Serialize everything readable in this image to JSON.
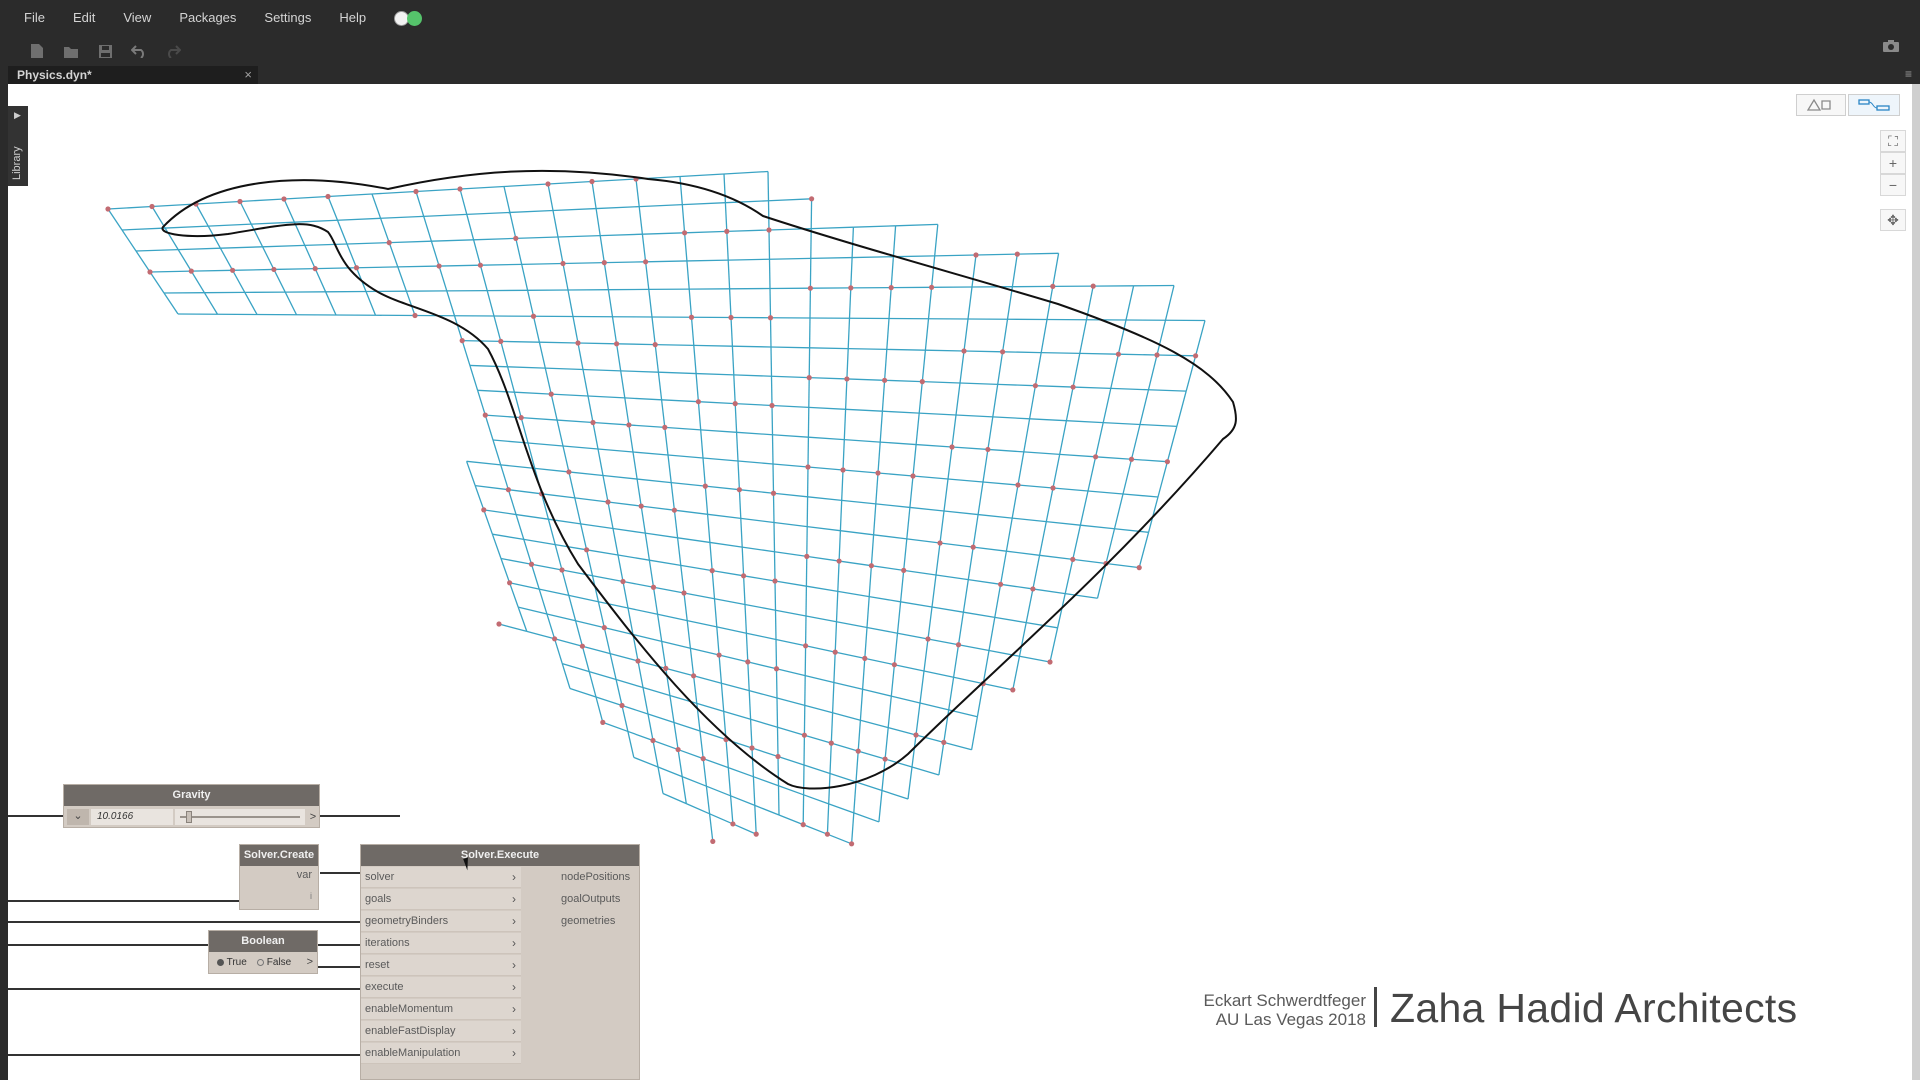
{
  "menu": {
    "items": [
      "File",
      "Edit",
      "View",
      "Packages",
      "Settings",
      "Help"
    ]
  },
  "toolbar": {
    "icons": [
      "new-file-icon",
      "open-file-icon",
      "save-icon",
      "undo-icon",
      "redo-icon"
    ],
    "camera_icon": "camera-icon"
  },
  "tab": {
    "title": "Physics.dyn*",
    "close": "×"
  },
  "library": {
    "label": "Library"
  },
  "view_controls": {
    "zoom_fit": "⛶",
    "zoom_in": "+",
    "zoom_out": "−",
    "pan": "✥"
  },
  "nodes": {
    "gravity": {
      "title": "Gravity",
      "value": "10.0166",
      "expand": "⌄",
      "more": ">"
    },
    "solver_create": {
      "title": "Solver.Create",
      "output": "var",
      "extra": "i"
    },
    "boolean": {
      "title": "Boolean",
      "option_true": "True",
      "option_false": "False",
      "more": ">"
    },
    "solver_execute": {
      "title": "Solver.Execute",
      "inputs": [
        "solver",
        "goals",
        "geometryBinders",
        "iterations",
        "reset",
        "execute",
        "enableMomentum",
        "enableFastDisplay",
        "enableManipulation"
      ],
      "outputs": [
        "nodePositions",
        "goalOutputs",
        "geometries"
      ]
    }
  },
  "credit": {
    "author": "Eckart Schwerdtfeger",
    "event": "AU Las Vegas 2018",
    "firm": "Zaha Hadid Architects"
  },
  "colors": {
    "mesh_line": "#3aa3c4",
    "node_point": "#c26b72",
    "boundary": "#111111",
    "status_warn": "#f2f2f2",
    "status_ok": "#55c36b"
  }
}
